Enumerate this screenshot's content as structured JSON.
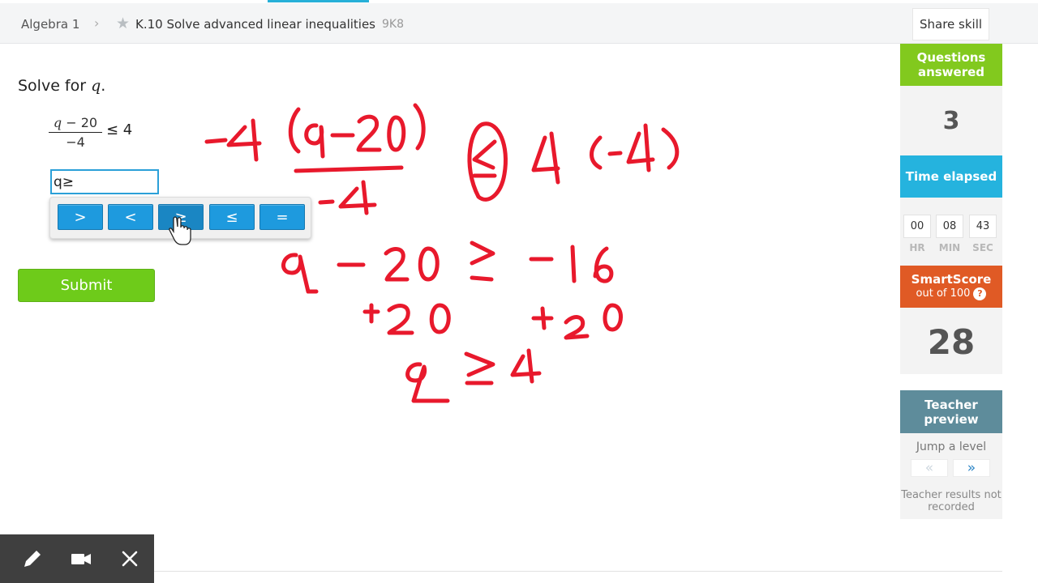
{
  "breadcrumb": {
    "course": "Algebra 1",
    "skill": "K.10 Solve advanced linear inequalities",
    "code": "9K8"
  },
  "header": {
    "share_label": "Share skill"
  },
  "question": {
    "prompt_prefix": "Solve for ",
    "prompt_var": "q",
    "prompt_suffix": ".",
    "frac_var": "q",
    "frac_num_rest": " − 20",
    "frac_den": "−4",
    "rhs": "≤ 4",
    "answer_value": "q≥"
  },
  "toolbar": {
    "buttons": [
      ">",
      "<",
      "≥",
      "≤",
      "="
    ]
  },
  "submit_label": "Submit",
  "sidebar": {
    "questions_answered_label": "Questions answered",
    "questions_answered_value": "3",
    "time_elapsed_label": "Time elapsed",
    "time": {
      "hr": "00",
      "min": "08",
      "sec": "43",
      "hr_label": "HR",
      "min_label": "MIN",
      "sec_label": "SEC"
    },
    "smartscore_label": "SmartScore",
    "smartscore_sub": "out of 100",
    "smartscore_value": "28",
    "teacher_preview_label": "Teacher preview",
    "jump_label": "Jump a level",
    "jump_back": "«",
    "jump_forward": "»",
    "not_recorded": "Teacher results not recorded"
  },
  "colors": {
    "green": "#82c91e",
    "blue": "#25b3de",
    "orange": "#e05a25",
    "teal": "#5e8c9b",
    "button_blue": "#1e9ade",
    "ink_red": "#e8192c"
  },
  "icons": {
    "breadcrumb_separator": "chevron-right-icon",
    "favorite": "star-icon",
    "help": "question-circle-icon",
    "pen": "pen-icon",
    "camera": "video-camera-icon",
    "close": "close-icon"
  }
}
